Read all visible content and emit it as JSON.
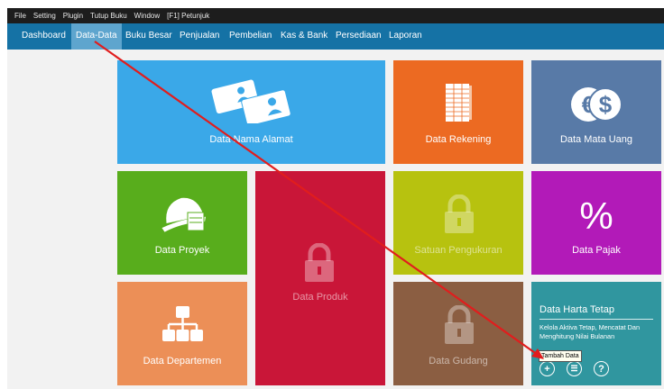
{
  "menu": [
    "File",
    "Setting",
    "Plugin",
    "Tutup Buku",
    "Window",
    "[F1] Petunjuk"
  ],
  "nav": [
    "Dashboard",
    "Data-Data",
    "Buku Besar",
    "Penjualan",
    "Pembelian",
    "Kas & Bank",
    "Persediaan",
    "Laporan"
  ],
  "tiles": {
    "nama_alamat": "Data Nama Alamat",
    "rekening": "Data Rekening",
    "mata_uang": "Data Mata Uang",
    "proyek": "Data Proyek",
    "produk": "Data Produk",
    "satuan": "Satuan Pengukuran",
    "pajak": "Data Pajak",
    "departemen": "Data Departemen",
    "gudang": "Data Gudang"
  },
  "harta": {
    "title": "Data Harta Tetap",
    "desc": "Kelola Aktiva Tetap, Mencatat Dan Menghitung Nilai Bulanan"
  },
  "tooltip": "Tambah Data",
  "colors": {
    "nama_alamat": "#3aa8e8",
    "rekening": "#ec6a22",
    "mata_uang": "#587aa7",
    "proyek": "#58ad1c",
    "produk": "#c91638",
    "satuan": "#b7c20f",
    "pajak": "#b21ab8",
    "departemen": "#ec8f57",
    "gudang": "#8b5e42",
    "harta": "#30969f"
  },
  "icons": [
    "address-cards-icon",
    "ledger-icon",
    "currency-icon",
    "hardhat-icon",
    "lock-icon",
    "percent-icon",
    "org-chart-icon",
    "add-icon",
    "list-icon",
    "help-icon"
  ]
}
